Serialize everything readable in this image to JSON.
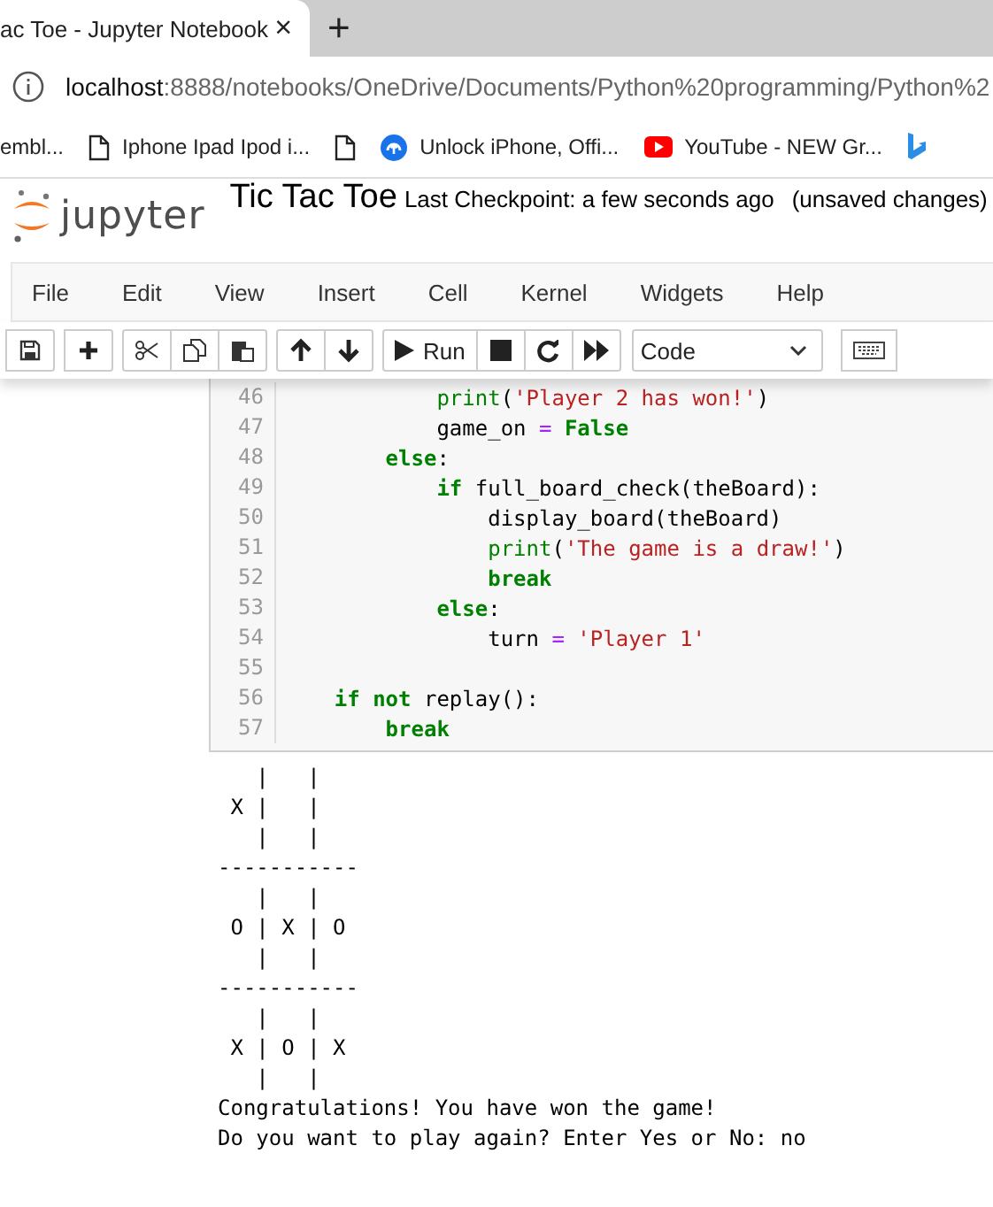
{
  "browser": {
    "tab_title": "ac Toe - Jupyter Notebook",
    "close": "×",
    "new_tab": "+",
    "address": {
      "host": "localhost",
      "path": ":8888/notebooks/OneDrive/Documents/Python%20programming/Python%2"
    },
    "bookmarks": [
      {
        "kind": "plain",
        "label": "embl..."
      },
      {
        "kind": "page",
        "label": "Iphone  Ipad  Ipod i..."
      },
      {
        "kind": "page"
      },
      {
        "kind": "unlock",
        "label": "Unlock iPhone, Offi..."
      },
      {
        "kind": "youtube",
        "label": "YouTube - NEW Gr..."
      },
      {
        "kind": "bing"
      }
    ]
  },
  "header": {
    "logo": "jupyter",
    "title": "Tic Tac Toe",
    "checkpoint": "Last Checkpoint: a few seconds ago",
    "status": "(unsaved changes)"
  },
  "menu": [
    "File",
    "Edit",
    "View",
    "Insert",
    "Cell",
    "Kernel",
    "Widgets",
    "Help"
  ],
  "toolbar": {
    "groups": [
      [
        {
          "kind": "save"
        }
      ],
      [
        {
          "kind": "add"
        }
      ],
      [
        {
          "kind": "cut"
        },
        {
          "kind": "copy"
        },
        {
          "kind": "paste"
        }
      ],
      [
        {
          "kind": "up"
        },
        {
          "kind": "down"
        }
      ],
      [
        {
          "kind": "run",
          "label": "Run"
        },
        {
          "kind": "stop"
        },
        {
          "kind": "restart"
        },
        {
          "kind": "fastforward"
        }
      ]
    ],
    "cell_type": "Code"
  },
  "code_lines": [
    {
      "number": "46",
      "tokens": [
        {
          "kind": "builtin",
          "text": "            print"
        },
        {
          "kind": "plain",
          "text": "("
        },
        {
          "kind": "string",
          "text": "'Player 2 has won!'"
        },
        {
          "kind": "plain",
          "text": ")"
        }
      ]
    },
    {
      "number": "47",
      "tokens": [
        {
          "kind": "plain",
          "text": "            game_on "
        },
        {
          "kind": "operator",
          "text": "="
        },
        {
          "kind": "keyword",
          "text": " False"
        }
      ]
    },
    {
      "number": "48",
      "tokens": [
        {
          "kind": "keyword",
          "text": "        else"
        },
        {
          "kind": "plain",
          "text": ":"
        }
      ]
    },
    {
      "number": "49",
      "tokens": [
        {
          "kind": "keyword",
          "text": "            if"
        },
        {
          "kind": "plain",
          "text": " full_board_check(theBoard):"
        }
      ]
    },
    {
      "number": "50",
      "tokens": [
        {
          "kind": "plain",
          "text": "                display_board(theBoard)"
        }
      ]
    },
    {
      "number": "51",
      "tokens": [
        {
          "kind": "builtin",
          "text": "                print"
        },
        {
          "kind": "plain",
          "text": "("
        },
        {
          "kind": "string",
          "text": "'The game is a draw!'"
        },
        {
          "kind": "plain",
          "text": ")"
        }
      ]
    },
    {
      "number": "52",
      "tokens": [
        {
          "kind": "keyword",
          "text": "                break"
        }
      ]
    },
    {
      "number": "53",
      "tokens": [
        {
          "kind": "keyword",
          "text": "            else"
        },
        {
          "kind": "plain",
          "text": ":"
        }
      ]
    },
    {
      "number": "54",
      "tokens": [
        {
          "kind": "plain",
          "text": "                turn "
        },
        {
          "kind": "operator",
          "text": "="
        },
        {
          "kind": "string",
          "text": " 'Player 1'"
        }
      ]
    },
    {
      "number": "55"
    },
    {
      "number": "56",
      "tokens": [
        {
          "kind": "keyword",
          "text": "    if not"
        },
        {
          "kind": "plain",
          "text": " replay():"
        }
      ]
    },
    {
      "number": "57",
      "tokens": [
        {
          "kind": "keyword",
          "text": "        break"
        }
      ]
    }
  ],
  "output_lines": [
    "   |   |",
    " X |   |",
    "   |   |",
    "-----------",
    "   |   |",
    " O | X | O",
    "   |   |",
    "-----------",
    "   |   |",
    " X | O | X",
    "   |   |",
    "Congratulations! You have won the game!",
    "Do you want to play again? Enter Yes or No: no"
  ]
}
